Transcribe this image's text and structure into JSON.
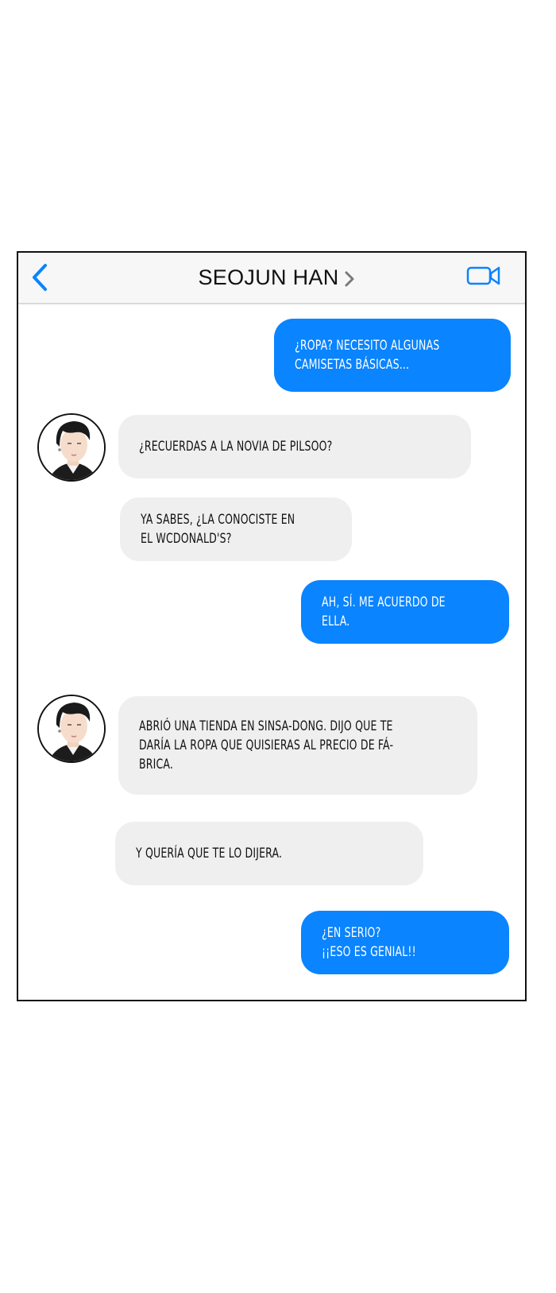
{
  "header": {
    "contact_name": "SEOJUN HAN",
    "back_icon": "chevron-left-icon",
    "detail_icon": "chevron-right-icon",
    "video_icon": "video-camera-icon"
  },
  "colors": {
    "sent_bubble": "#0a84ff",
    "received_bubble": "#efefef",
    "accent": "#0a84ff"
  },
  "messages": [
    {
      "sender": "me",
      "text": "¿ROPA? NECESITO ALGUNAS\nCAMISETAS BÁSICAS..."
    },
    {
      "sender": "contact",
      "text": "¿RECUERDAS A LA NOVIA DE PILSOO?"
    },
    {
      "sender": "contact",
      "text": "YA SABES, ¿LA CONOCISTE EN\nEL WCDONALD'S?"
    },
    {
      "sender": "me",
      "text": "AH, SÍ. ME ACUERDO DE\nELLA."
    },
    {
      "sender": "contact",
      "text": "ABRIÓ UNA TIENDA EN SINSA-DONG. DIJO QUE TE\nDARÍA LA ROPA QUE QUISIERAS AL PRECIO DE FÁ-\nBRICA."
    },
    {
      "sender": "contact",
      "text": "Y QUERÍA QUE TE LO DIJERA."
    },
    {
      "sender": "me",
      "text": "¿EN SERIO?\n¡¡ESO ES GENIAL!!"
    }
  ]
}
